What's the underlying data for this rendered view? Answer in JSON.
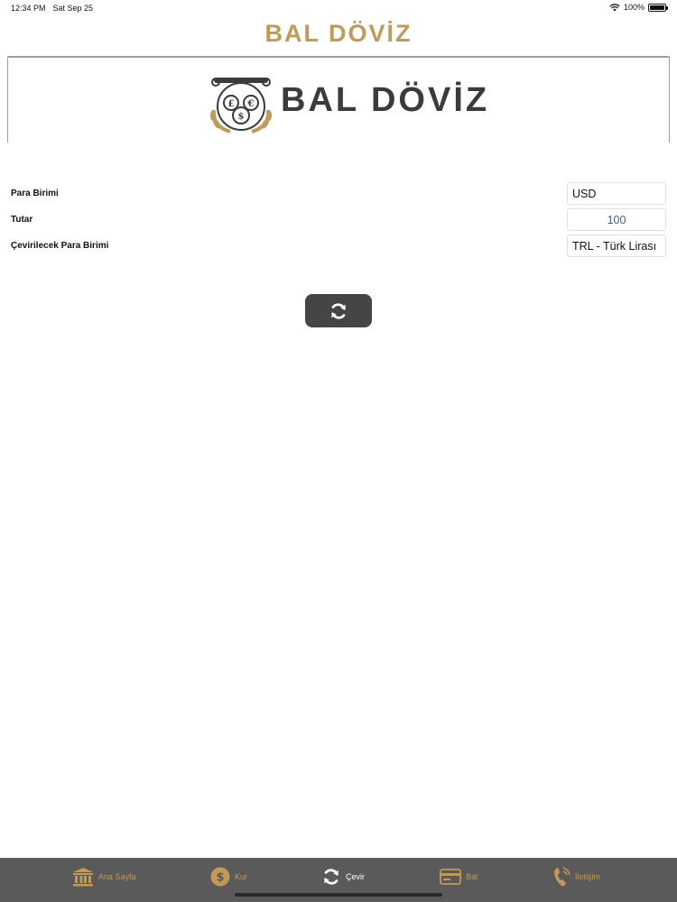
{
  "status_bar": {
    "time": "12:34 PM",
    "date": "Sat Sep 25",
    "battery": "100%"
  },
  "nav": {
    "title": "BAL DÖVİZ"
  },
  "banner": {
    "logo_text": "BAL DÖVİZ"
  },
  "form": {
    "currency_label": "Para Birimi",
    "currency_value": "USD",
    "amount_label": "Tutar",
    "amount_value": "100",
    "target_label": "Çevirilecek Para Birimi",
    "target_value": "TRL - Türk Lirası"
  },
  "convert_button": {
    "icon": "refresh-icon"
  },
  "tabs": [
    {
      "label": "Ana Sayfa",
      "icon": "bank-icon"
    },
    {
      "label": "Kur",
      "icon": "dollar-coin-icon"
    },
    {
      "label": "Çevir",
      "icon": "refresh-icon",
      "active": true
    },
    {
      "label": "Bal",
      "icon": "card-icon"
    },
    {
      "label": "İletişim",
      "icon": "phone-icon"
    }
  ],
  "colors": {
    "gold": "#c19a55",
    "tab_bar": "#5a5a5a",
    "button": "#454545"
  }
}
